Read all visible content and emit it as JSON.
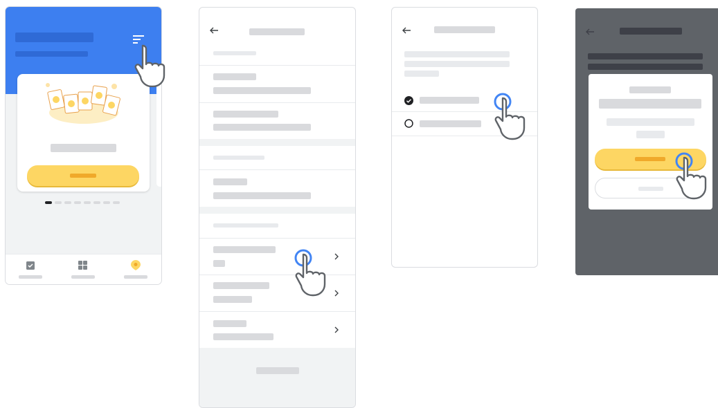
{
  "colors": {
    "header_blue": "#3d7ff0",
    "accent_yellow": "#fdd663",
    "button_text_bar": "#f0a92a",
    "placeholder_gray": "#d9dadd",
    "dark_overlay": "#5f6368",
    "tap_ring": "#4285f4",
    "section_gray": "#f1f3f4"
  },
  "icons": {
    "filter": "filter-icon",
    "back": "back-arrow-icon",
    "chevron": "chevron-right-icon",
    "check": "check-circle-icon",
    "radio": "radio-empty-icon",
    "hand": "pointing-hand-icon",
    "nav_1": "clipboard-icon",
    "nav_2": "grid-icon",
    "nav_3": "location-pin-icon"
  },
  "screens": {
    "home": {
      "carousel_pages": 8,
      "active_page": 1,
      "nav_items": 3,
      "active_nav": 3
    },
    "settings_list": {
      "groups": 3,
      "rows_with_chevron": 3
    },
    "choice": {
      "options": 2,
      "selected_option": 1
    },
    "dialog": {
      "buttons": 2
    }
  }
}
